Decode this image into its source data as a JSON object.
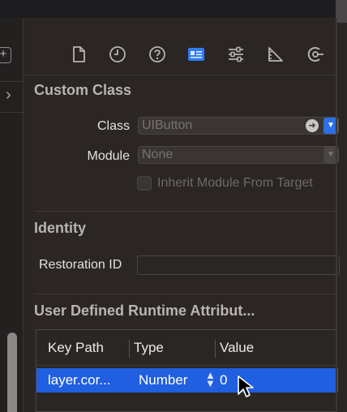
{
  "left_panel": {
    "add_glyph": "+",
    "chevron_glyph": "›"
  },
  "inspector_tabs": [
    {
      "icon": "file-icon"
    },
    {
      "icon": "history-icon"
    },
    {
      "icon": "help-icon"
    },
    {
      "icon": "identity-card-icon",
      "selected": true
    },
    {
      "icon": "sliders-icon"
    },
    {
      "icon": "ruler-icon"
    },
    {
      "icon": "connections-icon"
    }
  ],
  "custom_class": {
    "title": "Custom Class",
    "class_label": "Class",
    "class_placeholder": "UIButton",
    "module_label": "Module",
    "module_placeholder": "None",
    "inherit_label": "Inherit Module From Target"
  },
  "identity": {
    "title": "Identity",
    "restoration_label": "Restoration ID"
  },
  "runtime_attributes": {
    "title": "User Defined Runtime Attribut...",
    "columns": [
      "Key Path",
      "Type",
      "Value"
    ],
    "rows": [
      {
        "key_path": "layer.cor...",
        "type": "Number",
        "value": "0",
        "selected": true
      }
    ]
  },
  "colors": {
    "accent": "#2c6fe6",
    "selection": "#1f5fe0",
    "background": "#2b2624",
    "section_title": "#b9b4b2"
  }
}
